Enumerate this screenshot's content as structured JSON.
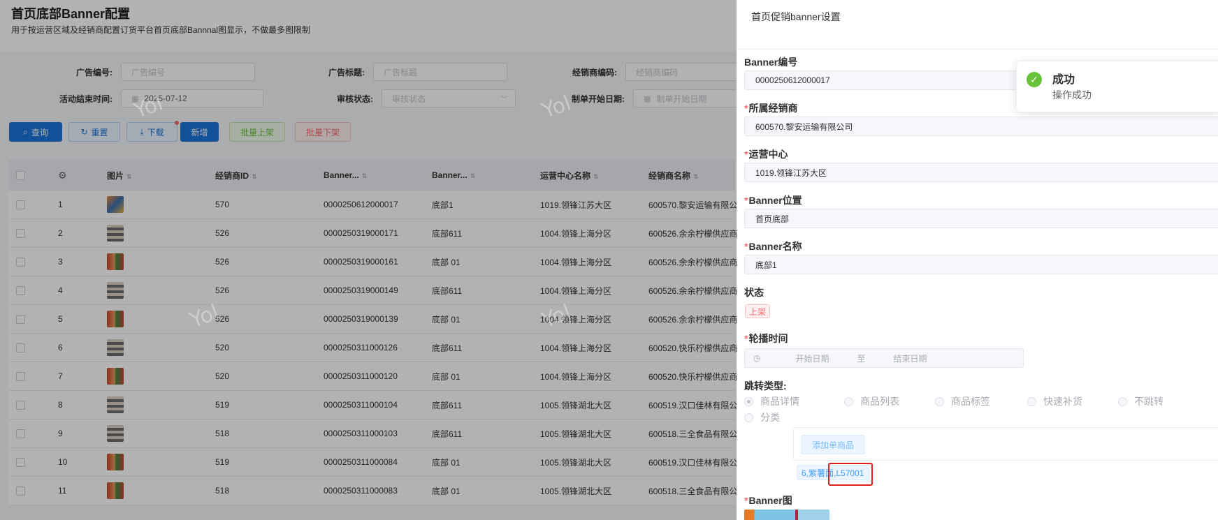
{
  "page": {
    "title": "首页底部Banner配置",
    "subtitle": "用于按运营区域及经销商配置订货平台首页底部Bannnal图显示，不做最多图限制"
  },
  "filters": {
    "ad_no_label": "广告编号:",
    "ad_no_placeholder": "广告编号",
    "ad_title_label": "广告标题:",
    "ad_title_placeholder": "广告标题",
    "dealer_code_label": "经销商编码:",
    "dealer_code_placeholder": "经销商编码",
    "end_time_label": "活动结束时间:",
    "end_time_value": "2025-07-12",
    "review_label": "审核状态:",
    "review_placeholder": "审核状态",
    "start_date_label": "制单开始日期:",
    "start_date_placeholder": "制单开始日期"
  },
  "toolbar": {
    "query": "查询",
    "reset": "重置",
    "download": "下载",
    "add": "新增",
    "batch_on": "批量上架",
    "batch_off": "批量下架"
  },
  "table": {
    "headers": [
      "图片",
      "经销商ID",
      "Banner...",
      "Banner...",
      "运营中心名称",
      "经销商名称"
    ],
    "rows": [
      {
        "no": "1",
        "img": "a",
        "dealer_id": "570",
        "banner_no": "0000250612000017",
        "banner_name": "底部1",
        "center": "1019.领锋江苏大区",
        "dealer": "600570.黎安运输有限公"
      },
      {
        "no": "2",
        "img": "b",
        "dealer_id": "526",
        "banner_no": "0000250319000171",
        "banner_name": "底部611",
        "center": "1004.领锋上海分区",
        "dealer": "600526.余余柠檬供应商"
      },
      {
        "no": "3",
        "img": "c",
        "dealer_id": "526",
        "banner_no": "0000250319000161",
        "banner_name": "底部 01",
        "center": "1004.领锋上海分区",
        "dealer": "600526.余余柠檬供应商"
      },
      {
        "no": "4",
        "img": "b",
        "dealer_id": "526",
        "banner_no": "0000250319000149",
        "banner_name": "底部611",
        "center": "1004.领锋上海分区",
        "dealer": "600526.余余柠檬供应商"
      },
      {
        "no": "5",
        "img": "c",
        "dealer_id": "526",
        "banner_no": "0000250319000139",
        "banner_name": "底部 01",
        "center": "1004.领锋上海分区",
        "dealer": "600526.余余柠檬供应商"
      },
      {
        "no": "6",
        "img": "b",
        "dealer_id": "520",
        "banner_no": "0000250311000126",
        "banner_name": "底部611",
        "center": "1004.领锋上海分区",
        "dealer": "600520.快乐柠檬供应商"
      },
      {
        "no": "7",
        "img": "c",
        "dealer_id": "520",
        "banner_no": "0000250311000120",
        "banner_name": "底部 01",
        "center": "1004.领锋上海分区",
        "dealer": "600520.快乐柠檬供应商"
      },
      {
        "no": "8",
        "img": "b",
        "dealer_id": "519",
        "banner_no": "0000250311000104",
        "banner_name": "底部611",
        "center": "1005.领锋湖北大区",
        "dealer": "600519.汉口佳林有限公"
      },
      {
        "no": "9",
        "img": "b",
        "dealer_id": "518",
        "banner_no": "0000250311000103",
        "banner_name": "底部611",
        "center": "1005.领锋湖北大区",
        "dealer": "600518.三全食品有限公"
      },
      {
        "no": "10",
        "img": "c",
        "dealer_id": "519",
        "banner_no": "0000250311000084",
        "banner_name": "底部 01",
        "center": "1005.领锋湖北大区",
        "dealer": "600519.汉口佳林有限公"
      },
      {
        "no": "11",
        "img": "c",
        "dealer_id": "518",
        "banner_no": "0000250311000083",
        "banner_name": "底部 01",
        "center": "1005.领锋湖北大区",
        "dealer": "600518.三全食品有限公"
      }
    ]
  },
  "watermark": "Yol",
  "drawer": {
    "title": "首页促销banner设置",
    "banner_no_label": "Banner编号",
    "banner_no_value": "0000250612000017",
    "dealer_label": "所属经销商",
    "dealer_value": "600570.黎安运输有限公司",
    "center_label": "运营中心",
    "center_value": "1019.领锋江苏大区",
    "position_label": "Banner位置",
    "position_value": "首页底部",
    "name_label": "Banner名称",
    "name_value": "底部1",
    "status_label": "状态",
    "status_value": "上架",
    "carousel_label": "轮播时间",
    "start_placeholder": "开始日期",
    "range_sep": "至",
    "end_placeholder": "结束日期",
    "jump_label": "跳转类型:",
    "jump_options": [
      "商品详情",
      "商品列表",
      "商品标签",
      "快速补货",
      "不跳转",
      "分类"
    ],
    "add_product": "添加单商品",
    "product_tag": "6,紫薯面,L57001",
    "banner_img_label": "Banner图",
    "required_mark": "*"
  },
  "toast": {
    "title": "成功",
    "message": "操作成功"
  },
  "colors": {
    "primary": "#1a73d9",
    "success": "#67c23a",
    "danger": "#f56c6c",
    "highlight": "#e02020"
  }
}
